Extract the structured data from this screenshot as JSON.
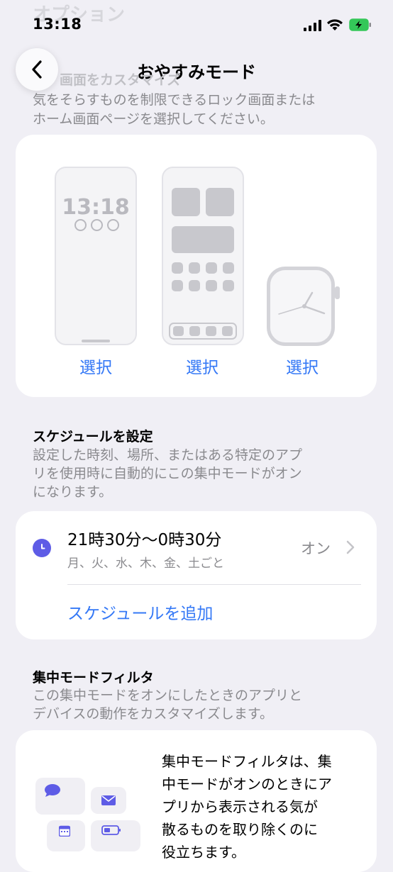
{
  "status_bar": {
    "time": "13:18"
  },
  "ghost_header": "オプション",
  "nav": {
    "title": "おやすみモード"
  },
  "customize": {
    "description": "気をそらすものを制限できるロック画面またはホーム画面ページを選択してください。",
    "line1": "気をそらすものを制限できるロック画面または",
    "line2": "ホーム画面ページを選択してください。",
    "heading_fragment": "画面をカスタマイズ",
    "lock_time": "13:18",
    "select_lock": "選択",
    "select_home": "選択",
    "select_watch": "選択"
  },
  "schedule": {
    "title": "スケジュールを設定",
    "desc_line1": "設定した時刻、場所、またはある特定のアプ",
    "desc_line2": "リを使用時に自動的にこの集中モードがオン",
    "desc_line3": "になります。",
    "item_time": "21時30分〜0時30分",
    "item_days": "月、火、水、木、金、土ごと",
    "item_status": "オン",
    "add_label": "スケジュールを追加"
  },
  "filters": {
    "title": "集中モードフィルタ",
    "desc_line1": "この集中モードをオンにしたときのアプリと",
    "desc_line2": "デバイスの動作をカスタマイズします。",
    "card_line1": "集中モードフィルタは、集",
    "card_line2": "中モードがオンのときにア",
    "card_line3": "プリから表示される気が",
    "card_line4": "散るものを取り除くのに",
    "card_line5": "役立ちます。"
  },
  "colors": {
    "accent": "#3478f6",
    "focus_purple": "#5e5ce6",
    "battery_green": "#34c759"
  },
  "icons": [
    "back-chevron-icon",
    "signal-icon",
    "wifi-icon",
    "battery-charging-icon",
    "clock-icon",
    "chevron-right-icon",
    "message-icon",
    "mail-icon",
    "calendar-icon",
    "battery-icon"
  ]
}
